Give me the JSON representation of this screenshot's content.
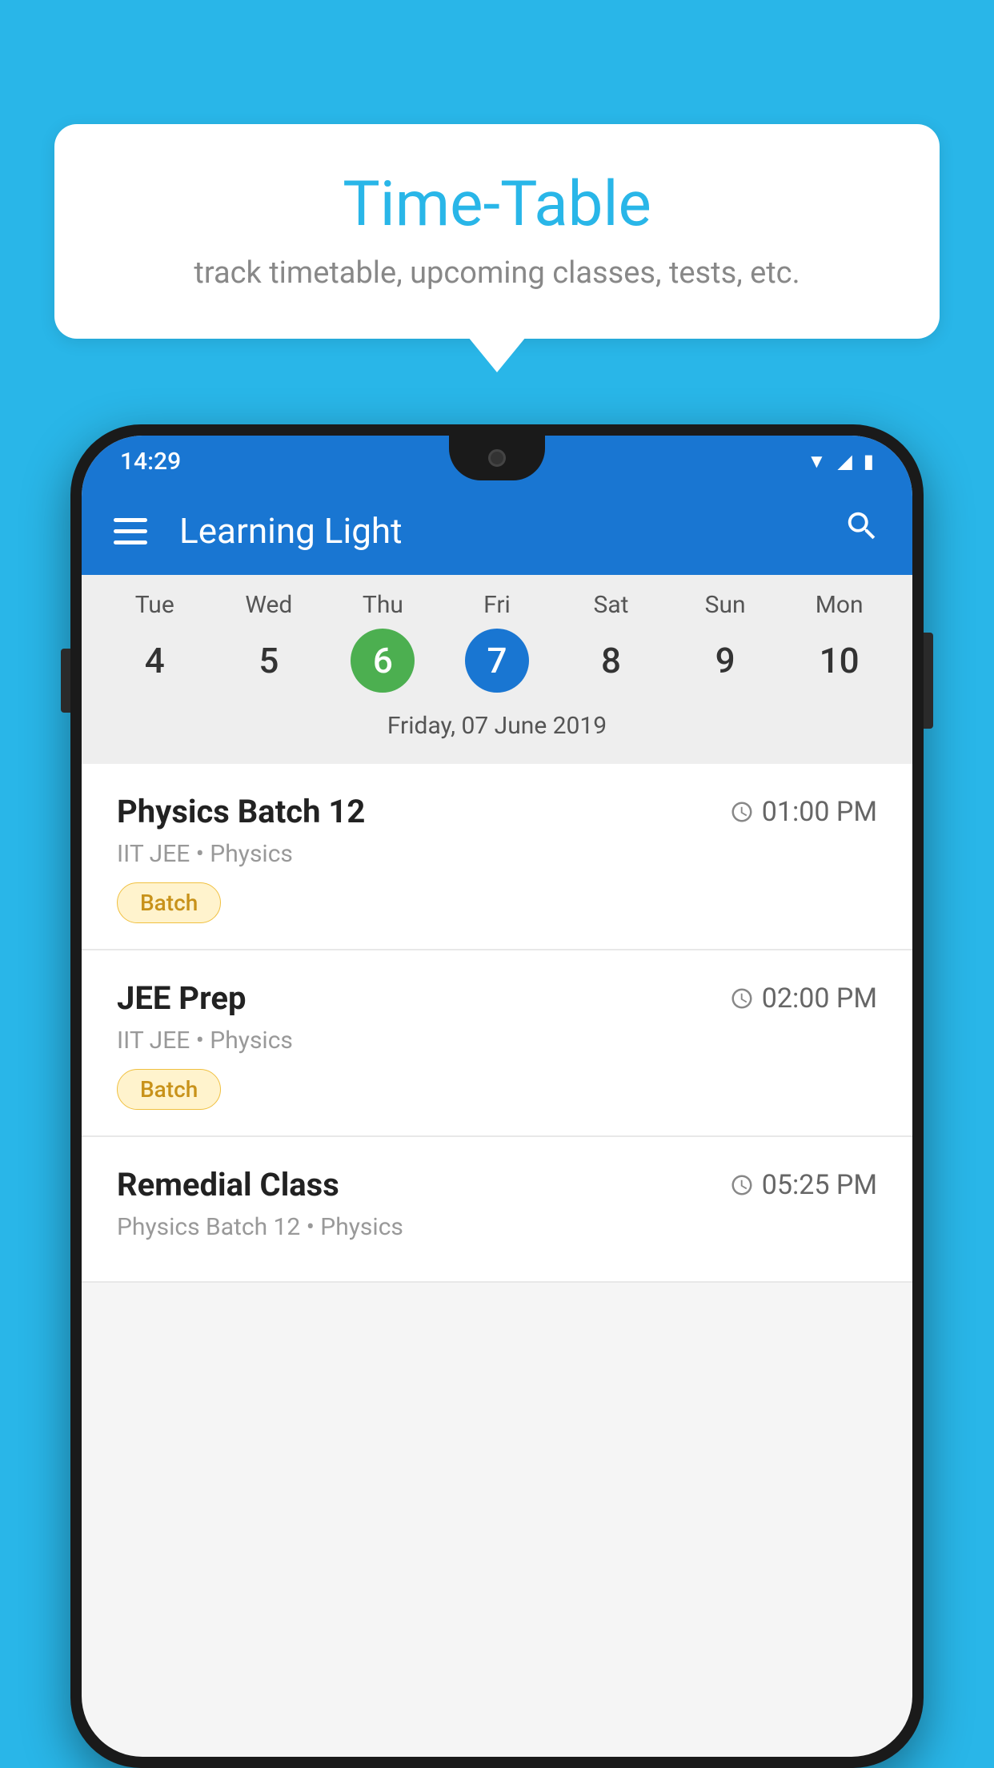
{
  "background_color": "#29b6e8",
  "speech_bubble": {
    "title": "Time-Table",
    "subtitle": "track timetable, upcoming classes, tests, etc."
  },
  "phone": {
    "status_bar": {
      "time": "14:29"
    },
    "app_bar": {
      "title": "Learning Light"
    },
    "calendar": {
      "days": [
        {
          "name": "Tue",
          "number": "4",
          "state": "normal"
        },
        {
          "name": "Wed",
          "number": "5",
          "state": "normal"
        },
        {
          "name": "Thu",
          "number": "6",
          "state": "today"
        },
        {
          "name": "Fri",
          "number": "7",
          "state": "selected"
        },
        {
          "name": "Sat",
          "number": "8",
          "state": "normal"
        },
        {
          "name": "Sun",
          "number": "9",
          "state": "normal"
        },
        {
          "name": "Mon",
          "number": "10",
          "state": "normal"
        }
      ],
      "selected_date_label": "Friday, 07 June 2019"
    },
    "schedule": [
      {
        "title": "Physics Batch 12",
        "time": "01:00 PM",
        "subtitle": "IIT JEE • Physics",
        "tag": "Batch"
      },
      {
        "title": "JEE Prep",
        "time": "02:00 PM",
        "subtitle": "IIT JEE • Physics",
        "tag": "Batch"
      },
      {
        "title": "Remedial Class",
        "time": "05:25 PM",
        "subtitle": "Physics Batch 12 • Physics",
        "tag": null
      }
    ]
  }
}
